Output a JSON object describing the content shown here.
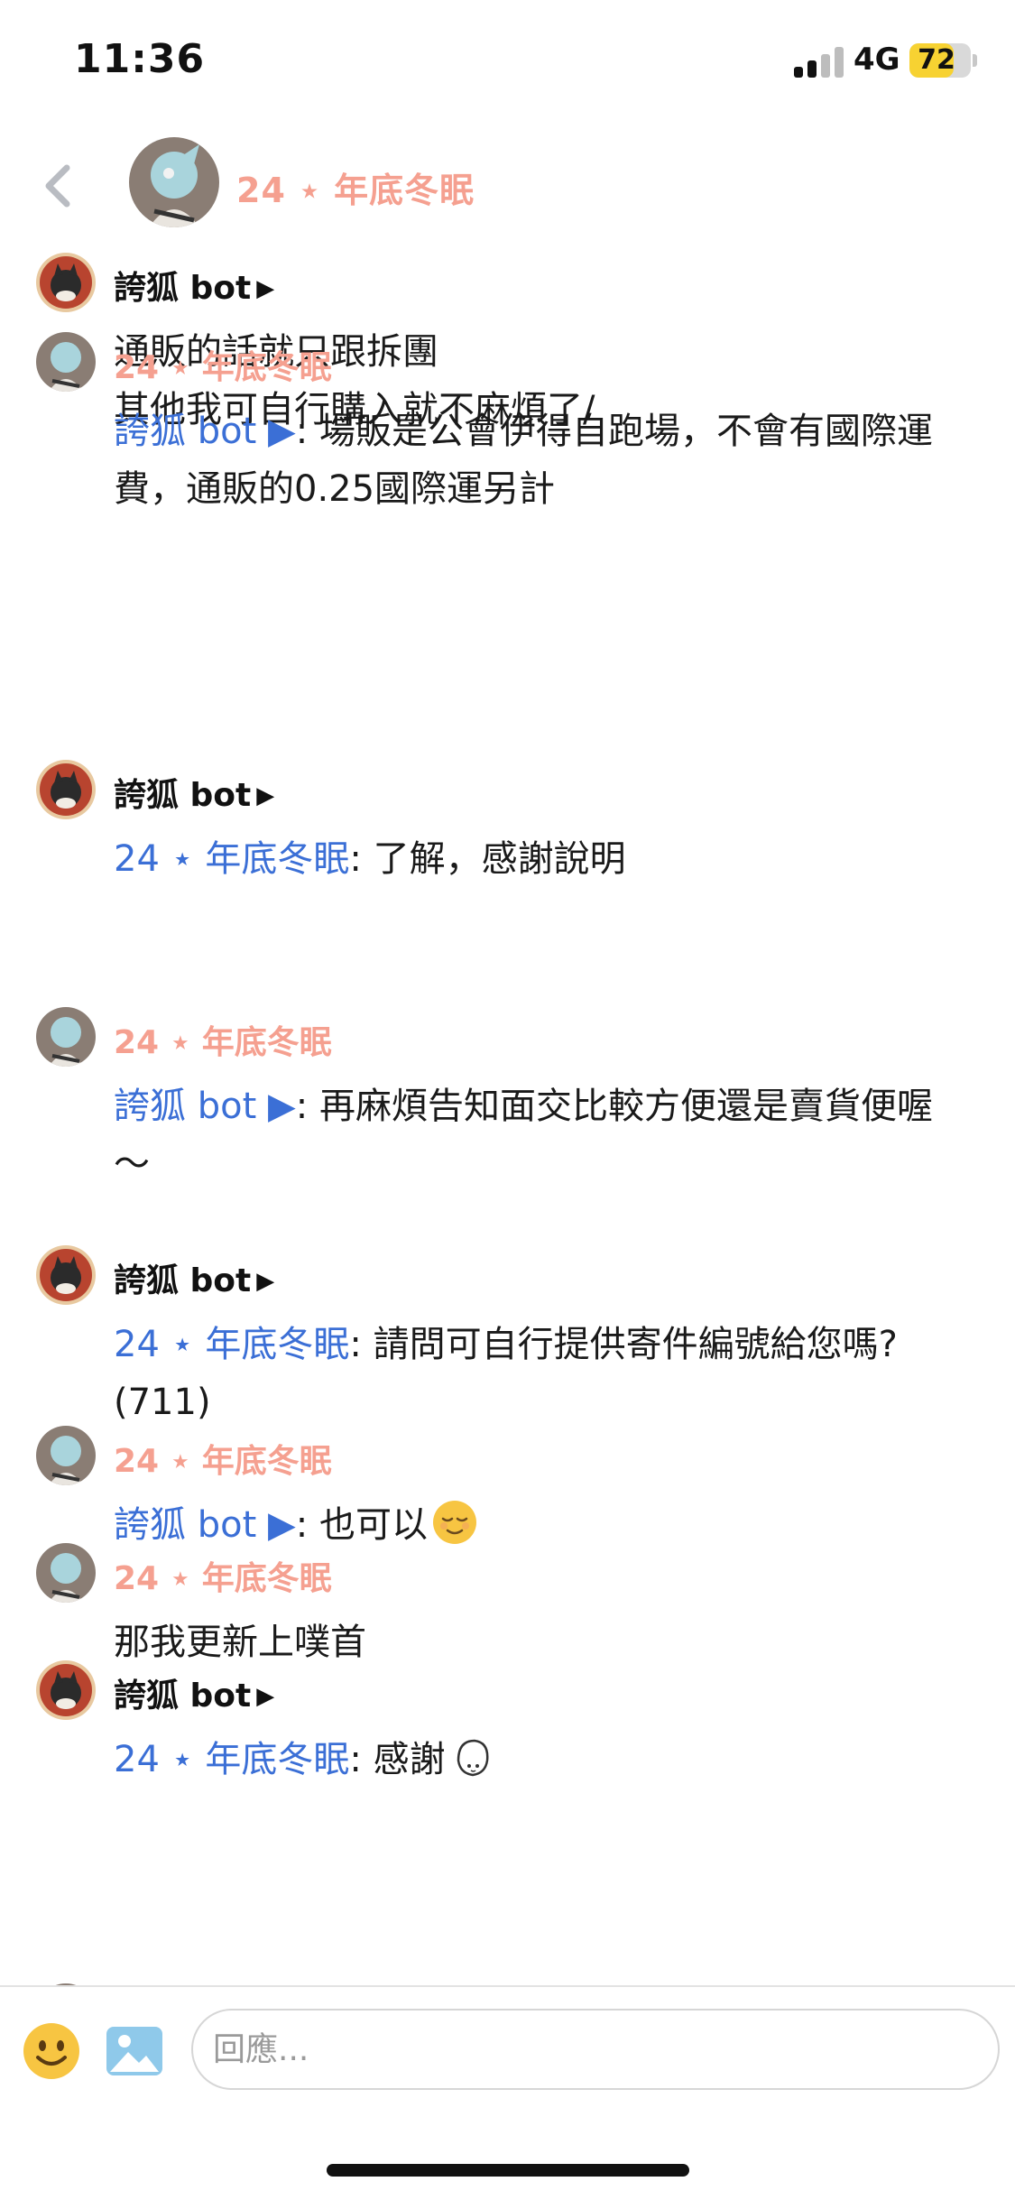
{
  "status_bar": {
    "time": "11:36",
    "network": "4G",
    "battery": "72",
    "battery_level": 0.72,
    "battery_color": "#f7d232"
  },
  "header": {
    "title": "24 ⋆ 年底冬眠",
    "back_icon": "chevron-left-icon"
  },
  "colors": {
    "mention": "#3b6fd6",
    "user_name": "#f5a090",
    "bot_name": "#111111"
  },
  "messages": [
    {
      "sender": "誇狐 bot",
      "sender_type": "bot",
      "mention": "",
      "text": "通販的話就只跟拆團\n其他我可自行購入就不麻煩了/"
    },
    {
      "sender": "24 ⋆ 年底冬眠",
      "sender_type": "user",
      "mention": "誇狐 bot ▶",
      "text": ": 場販是公會伊得自跑場，不會有國際運費，通販的0.25國際運另計"
    },
    {
      "sender": "誇狐 bot",
      "sender_type": "bot",
      "mention": "24 ⋆ 年底冬眠",
      "text": ": 了解，感謝說明"
    },
    {
      "sender": "24 ⋆ 年底冬眠",
      "sender_type": "user",
      "mention": "誇狐 bot ▶",
      "text": ": 再麻煩告知面交比較方便還是賣貨便喔～"
    },
    {
      "sender": "誇狐 bot",
      "sender_type": "bot",
      "mention": "24 ⋆ 年底冬眠",
      "text": ": 請問可自行提供寄件編號給您嗎?(711)"
    },
    {
      "sender": "24 ⋆ 年底冬眠",
      "sender_type": "user",
      "mention": "誇狐 bot ▶",
      "text": ": 也可以"
    },
    {
      "sender": "24 ⋆ 年底冬眠",
      "sender_type": "user",
      "mention": "",
      "text": "那我更新上噗首"
    },
    {
      "sender": "誇狐 bot",
      "sender_type": "bot",
      "mention": "24 ⋆ 年底冬眠",
      "text": ": 感謝"
    }
  ],
  "compose": {
    "placeholder": "回應...",
    "emoji_icon": "smiley-icon",
    "image_icon": "image-icon"
  }
}
